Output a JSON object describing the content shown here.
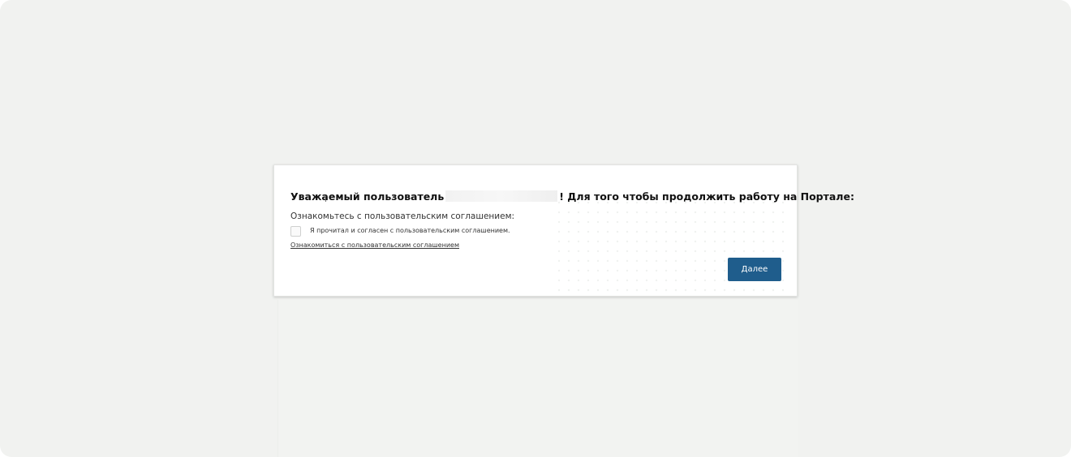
{
  "dialog": {
    "title_prefix": "Уважаемый пользователь",
    "title_suffix": "! Для того чтобы продолжить работу на Портале:",
    "subtitle": "Ознакомьтесь с пользовательским соглашением:",
    "checkbox_label": "Я прочитал и согласен с пользовательским соглашением.",
    "agreement_link": "Ознакомиться с пользовательским соглашением",
    "next_button": "Далее"
  },
  "colors": {
    "accent": "#1f5d8c",
    "page_background": "#f1f2f0"
  }
}
